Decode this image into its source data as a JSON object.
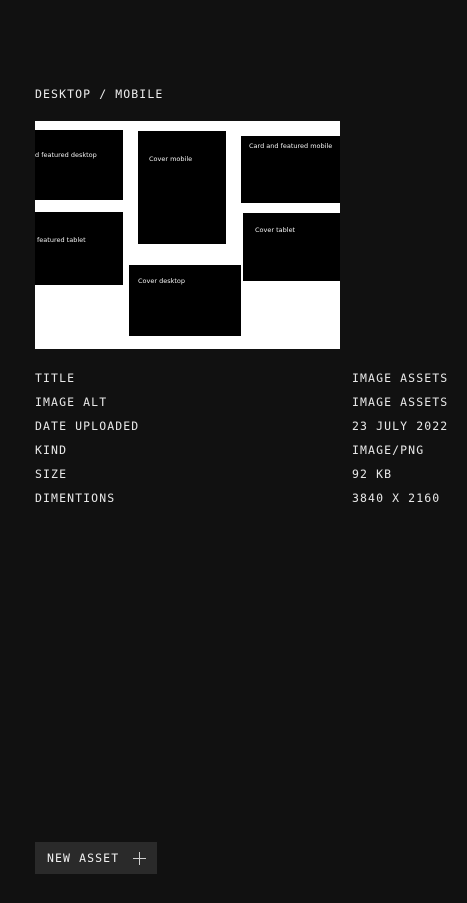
{
  "breadcrumb": "DESKTOP / MOBILE",
  "preview": {
    "tiles": [
      {
        "label": "d featured desktop"
      },
      {
        "label": "Cover mobile"
      },
      {
        "label": "Card and featured mobile"
      },
      {
        "label": "featured tablet"
      },
      {
        "label": "Cover tablet"
      },
      {
        "label": "Cover desktop"
      }
    ]
  },
  "meta": [
    {
      "key": "TITLE",
      "value": "IMAGE ASSETS"
    },
    {
      "key": "IMAGE ALT",
      "value": "IMAGE ASSETS"
    },
    {
      "key": "DATE UPLOADED",
      "value": "23 JULY 2022"
    },
    {
      "key": "KIND",
      "value": "IMAGE/PNG"
    },
    {
      "key": "SIZE",
      "value": "92 KB"
    },
    {
      "key": "DIMENTIONS",
      "value": "3840 X 2160"
    }
  ],
  "actions": {
    "new_asset_label": "NEW ASSET",
    "new_asset_icon": "plus-icon"
  },
  "colors": {
    "background": "#111111",
    "text": "#e8e8e8",
    "button_bg": "#2a2a2a",
    "preview_bg": "#ffffff",
    "tile_bg": "#000000"
  }
}
